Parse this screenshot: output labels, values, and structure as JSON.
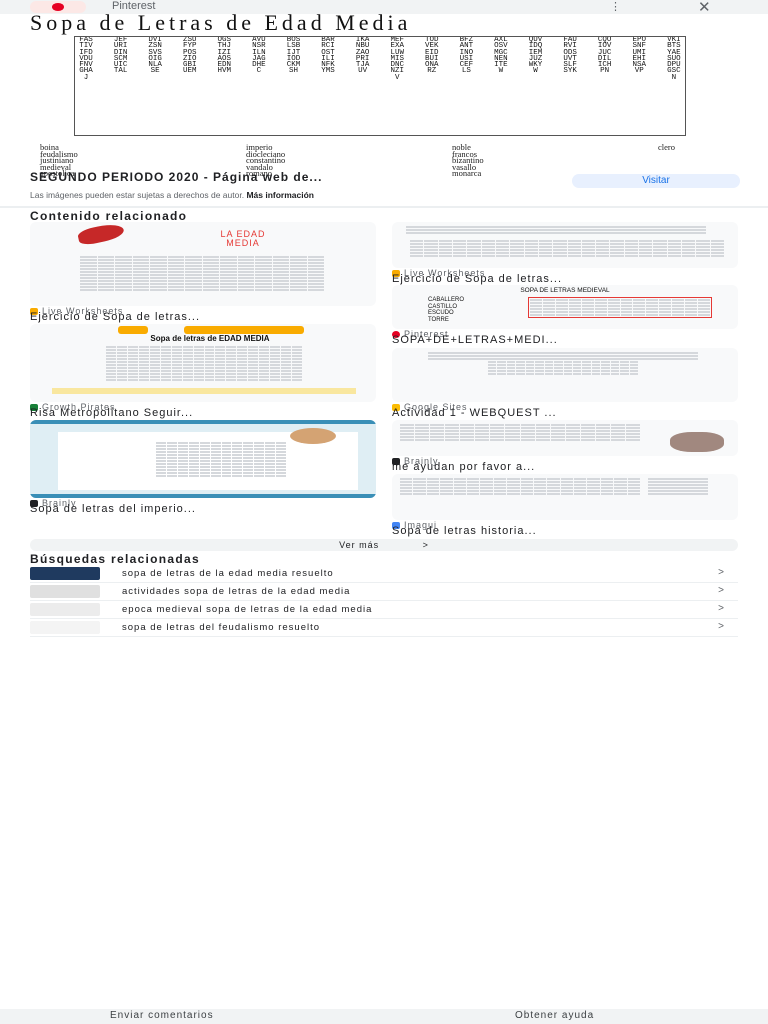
{
  "topbar": {
    "source_name": "Pinterest",
    "more_label": "⋮",
    "close_label": "✕"
  },
  "hero": {
    "title": "Sopa de Letras de Edad Media",
    "grid_columns": [
      "FASTIVIFDVDUFNVGHAJ",
      "JEFURIDINSCMUICTAL",
      "DVIZSNSVSOIGNLASE",
      "ZSUFYPPOSZIOGBIUEM",
      "OGSTHJIZIAOSEDNHVM",
      "AVUNSRILNJAGDHEC",
      "BOSLSBIJTIODCKMSH",
      "BARRCIOSTILINFKYMS",
      "IKANBUZAOPRITJAUV",
      "MEFEXALUWMISDNCNZIV",
      "TODVEKEIDBUIONARZ",
      "BFZANTINOUSICEFLS",
      "AXLOSVMGCNENITEW",
      "QUVIDQIEMJUZWKYW",
      "FAURVIODSUVTSLFSYK",
      "CQOIOVJUCDILICHPN",
      "EPOSNFUMIEHINSAVP",
      "VKIBTSYAESUODPUGSCN"
    ],
    "word_columns": [
      [
        "boina",
        "feudalismo",
        "justiniano",
        "medieval",
        "apostolica"
      ],
      [
        "imperio",
        "diocleciano",
        "constantino",
        "vandalo",
        "romano"
      ],
      [
        "noble",
        "francos",
        "bizantino",
        "vasallo",
        "monarca"
      ],
      [
        "clero"
      ]
    ]
  },
  "result": {
    "title": "SEGUNDO PERIODO 2020 - Página web de...",
    "visit_label": "Visitar",
    "copyright_text": "Las imágenes pueden estar sujetas a derechos de autor.",
    "more_info_label": "Más información"
  },
  "related": {
    "heading": "Contenido relacionado",
    "cards": [
      {
        "thumb_heading": "LA EDAD MEDIA",
        "source": "Live Worksheets",
        "title": "Ejercicio de Sopa de letras..."
      },
      {
        "thumb_heading": "SOPA DE LETRAS MEDIEVAL",
        "thumb_words": [
          "CABALLERO",
          "CASTILLO",
          "ESCUDO",
          "TORRE"
        ],
        "source": "Live Worksheets",
        "title": "Ejercicio de Sopa de letras..."
      },
      {
        "thumb_heading": "Sopa de letras de EDAD MEDIA",
        "source": "Pinterest",
        "title": "SOPA+DE+LETRAS+MEDI..."
      },
      {
        "source": "Growth Pirates",
        "title": "Risa Metropolitano Seguir..."
      },
      {
        "source": "Google Sites",
        "title": "Actividad 1 - WEBQUEST ..."
      },
      {
        "source": "Brainly",
        "title": "me ayudan por favor a..."
      },
      {
        "source": "Brainly",
        "title": "Sopa de letras del imperio..."
      },
      {
        "source": "Imagui",
        "title": "Sopa de letras historia..."
      }
    ],
    "see_more_label": "Ver más",
    "see_more_arrow": ">"
  },
  "searches": {
    "heading": "Búsquedas relacionadas",
    "items": [
      "sopa de letras de la edad media resuelto",
      "actividades sopa de letras de la edad media",
      "epoca medieval sopa de letras de la edad media",
      "sopa de letras del feudalismo resuelto"
    ],
    "chevron": ">"
  },
  "footer": {
    "feedback_label": "Enviar comentarios",
    "help_label": "Obtener ayuda"
  },
  "colors": {
    "accent": "#1a73e8",
    "pinterest": "#e60023",
    "edad_media_red": "#e53935",
    "chip_bg": "#e8f0fe"
  }
}
